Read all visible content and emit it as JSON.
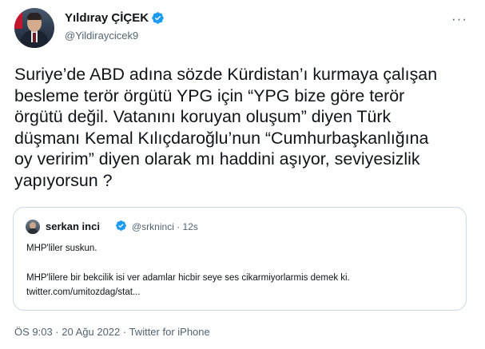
{
  "author": {
    "name": "Yıldıray ÇİÇEK",
    "handle": "@Yildiraycicek9"
  },
  "more_label": "···",
  "tweet_text": "Suriye’de ABD adına sözde Kürdistan’ı kurmaya çalışan\nbesleme terör örgütü YPG için “YPG bize göre terör\nörgütü değil. Vatanını koruyan oluşum” diyen Türk\ndüşmanı Kemal Kılıçdaroğlu’nun “Cumhurbaşkanlığına\noy veririm” diyen olarak mı haddini aşıyor, seviyesizlik\nyapıyorsun ?",
  "quoted": {
    "name": "serkan inci",
    "handle_time": "@srkninci · 12s",
    "line1": "MHP'liler suskun.",
    "line2": "MHP'lilere bir bekcilik isi ver adamlar hicbir seye ses cikarmiyorlarmis demek ki.",
    "line3": "twitter.com/umitozdag/stat..."
  },
  "meta": "ÖS 9:03 · 20 Ağu 2022 · Twitter for iPhone",
  "colors": {
    "verified": "#1d9bf0",
    "secondary_text": "#536471",
    "border": "#cfd9de"
  }
}
